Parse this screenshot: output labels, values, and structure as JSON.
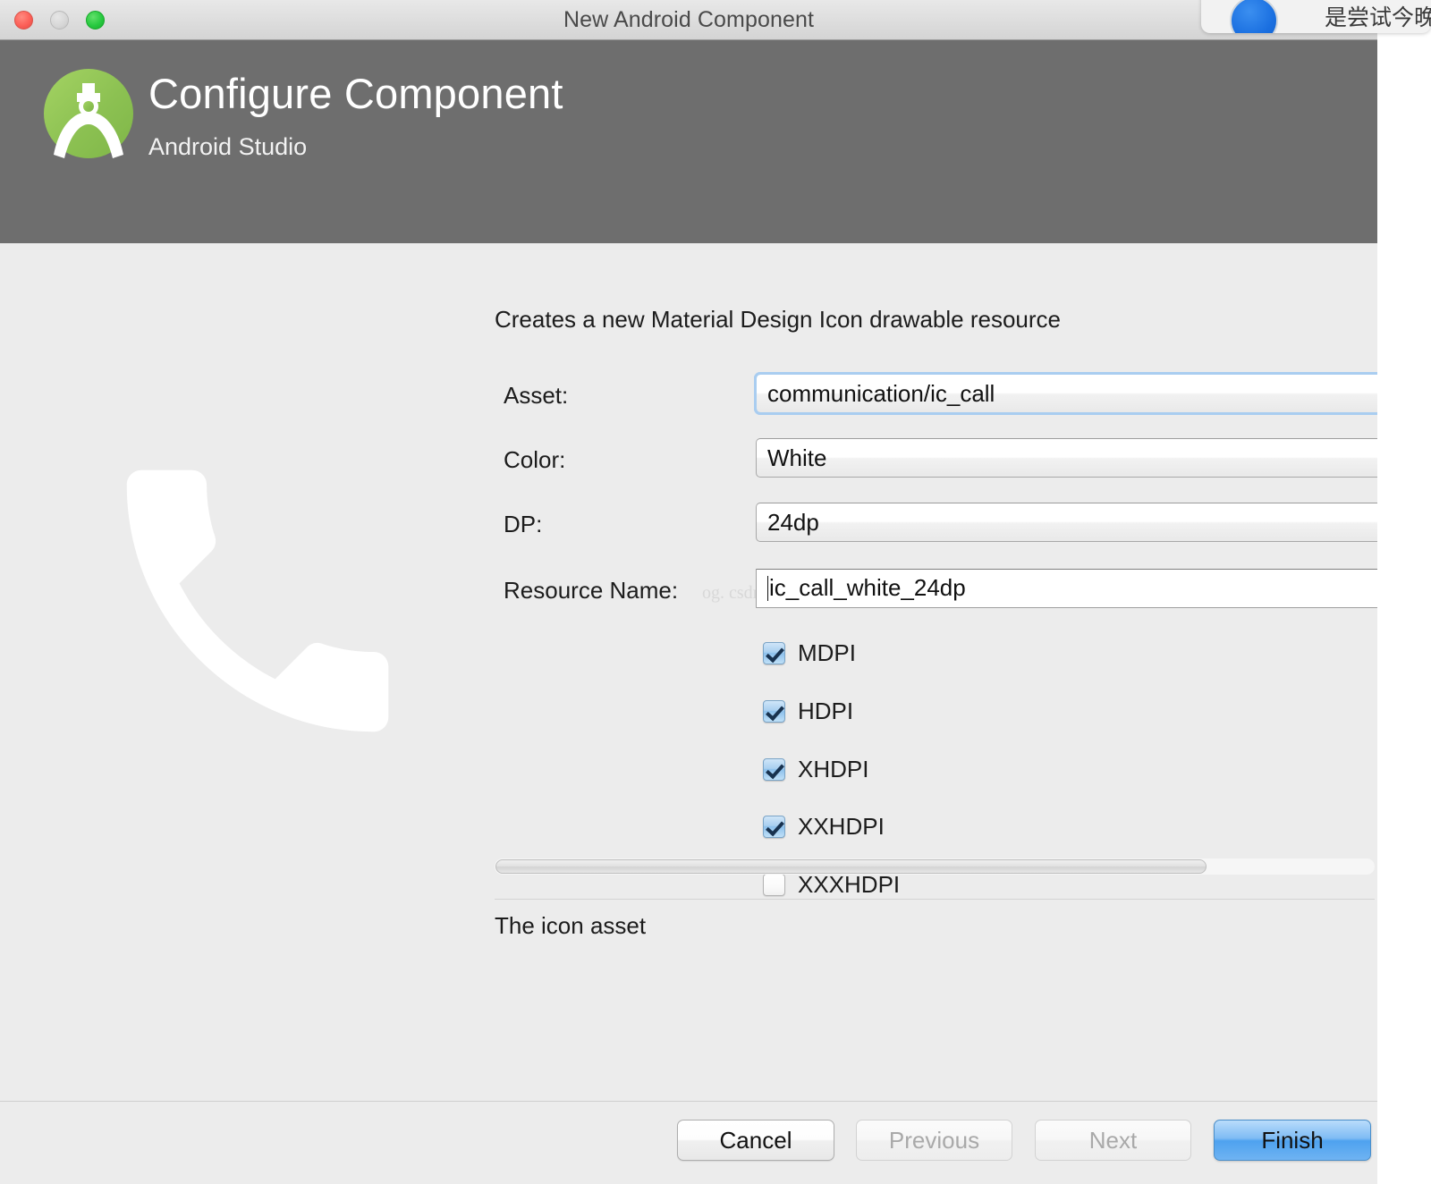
{
  "window": {
    "title": "New Android Component",
    "traffic_lights": [
      "close-button",
      "minimize-button",
      "zoom-button"
    ]
  },
  "banner": {
    "title": "Configure Component",
    "subtitle": "Android Studio",
    "logo": "android-studio-logo"
  },
  "main": {
    "description": "Creates a new Material Design Icon drawable resource",
    "preview_icon": "phone-call-icon",
    "watermark": "og. csdn.",
    "fields": [
      {
        "label": "Asset:",
        "value": "communication/ic_call",
        "type": "combo",
        "focused": true
      },
      {
        "label": "Color:",
        "value": "White",
        "type": "combo",
        "focused": false
      },
      {
        "label": "DP:",
        "value": "24dp",
        "type": "combo",
        "focused": false
      },
      {
        "label": "Resource Name:",
        "value": "ic_call_white_24dp",
        "type": "text",
        "focused": false
      }
    ],
    "densities": [
      {
        "label": "MDPI",
        "checked": true
      },
      {
        "label": "HDPI",
        "checked": true
      },
      {
        "label": "XHDPI",
        "checked": true
      },
      {
        "label": "XXHDPI",
        "checked": true
      },
      {
        "label": "XXXHDPI",
        "checked": false
      }
    ],
    "footnote": "The icon asset",
    "scrollbar": {
      "orientation": "horizontal",
      "thumb_fraction": 0.81
    }
  },
  "buttons": {
    "cancel": "Cancel",
    "previous": "Previous",
    "next": "Next",
    "finish": "Finish"
  },
  "notification": {
    "text": "是尝试今晚安",
    "button_icon": "blue-circle-button"
  },
  "colors": {
    "banner_bg": "#6e6e6e",
    "content_bg": "#ececec",
    "accent_blue": "#4ea2ef",
    "logo_green": "#8cc152",
    "focus_ring": "#a9cdf0"
  }
}
